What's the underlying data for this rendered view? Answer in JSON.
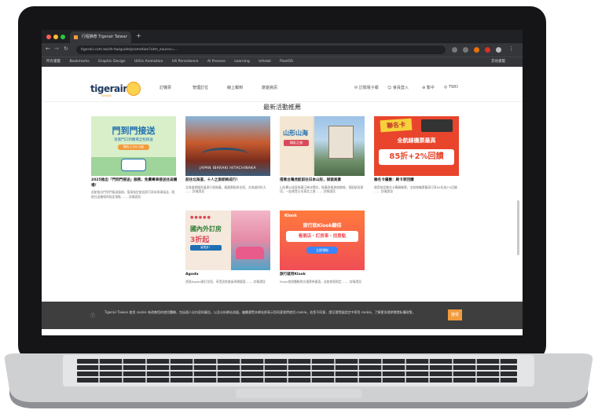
{
  "browser": {
    "tab_title": "行程推荐 Tigerair Taiwan | 台灣虎航",
    "url": "tigerair.com.tw/zh-tw/guide/promotion?utm_source=...",
    "bookmarks": [
      "所有書籤",
      "Bookmarks",
      "Graphic Design",
      "UI/Ux Animation",
      "UX Persistence",
      "AI Process",
      "Learning",
      "Infodal",
      "PixelOS",
      "其他書籤"
    ]
  },
  "header": {
    "logo": "tigerair",
    "logo_sub": "TAIWAN",
    "nav": [
      "訂機票",
      "管理訂位",
      "線上報到",
      "旅遊資訊"
    ],
    "utilities": [
      "訂閱電子報",
      "會員登入",
      "繁中",
      "TWD"
    ]
  },
  "main": {
    "section_title": "最新活動推薦",
    "cards": [
      {
        "title": "2025推出「門到門接送」服務，免費專車接送往返機場！",
        "desc": "虎航推出門到門接送服務，搭乘指定航班即可享有專車接送，輕鬆往返機場與指定地點 …… 詳情請見",
        "img": {
          "headline": "門到門接送",
          "sub": "從家門口到機場全程接送",
          "badge": "限時 2,300 元起"
        }
      },
      {
        "title": "前往北海道，十人之旅即將成行！",
        "desc": "北海道賞楓與溫泉行程推薦，精選景點與住宿，北海道的秋天 …… 詳情請見",
        "img": {
          "caption": "JAPAN IBARAKI HITACHINAKA"
        }
      },
      {
        "title": "搭乘台灣虎航前往日本山形，探索美景",
        "desc": "山形縣以溫泉與藏王樹冰聞名，推薦多條旅遊路線，搭配航班資訊，一起感受日本東北之美 …… 詳情請見",
        "img": {
          "headline": "山形山海",
          "sub": "精彩之旅"
        }
      },
      {
        "title": "聯名卡優惠：刷卡享回饋",
        "desc": "使用指定聯名卡購買機票，全航線機票最高可享85折加2%回饋 …… 詳情請見",
        "img": {
          "tag": "聯名卡",
          "headline": "全航線機票最高",
          "big": "85折+2%回饋"
        }
      },
      {
        "title": "Agoda",
        "desc": "透過Agoda預訂住宿，享受虎航會員專屬優惠 …… 詳情請見",
        "img": {
          "headline": "國內外訂房",
          "sub": "3折起",
          "badge": "省很多！"
        }
      },
      {
        "title": "旅行就用Klook",
        "desc": "Klook旅遊體驗與交通票券優惠，虎航旅客限定 …… 詳情請見",
        "img": {
          "brand": "Klook",
          "headline": "旅行就Klook翻倍",
          "sub": "看展店・訂房車・找景點",
          "btn": "立即領取"
        }
      }
    ]
  },
  "cookie_banner": {
    "text": "Tigerair Taiwan 使用 cookie 來改善您的使用體驗，包括個人化內容與廣告，以及分析網站流量。繼續瀏覽本網站即表示您同意我們使用 cookie。若您不同意，請至瀏覽器設定中停用 cookie。了解更多請參閱隱私權政策。",
    "button": "接受"
  },
  "colors": {
    "accent": "#f39c3d",
    "brand_navy": "#1e3a5f",
    "chrome_dark": "#202124"
  }
}
